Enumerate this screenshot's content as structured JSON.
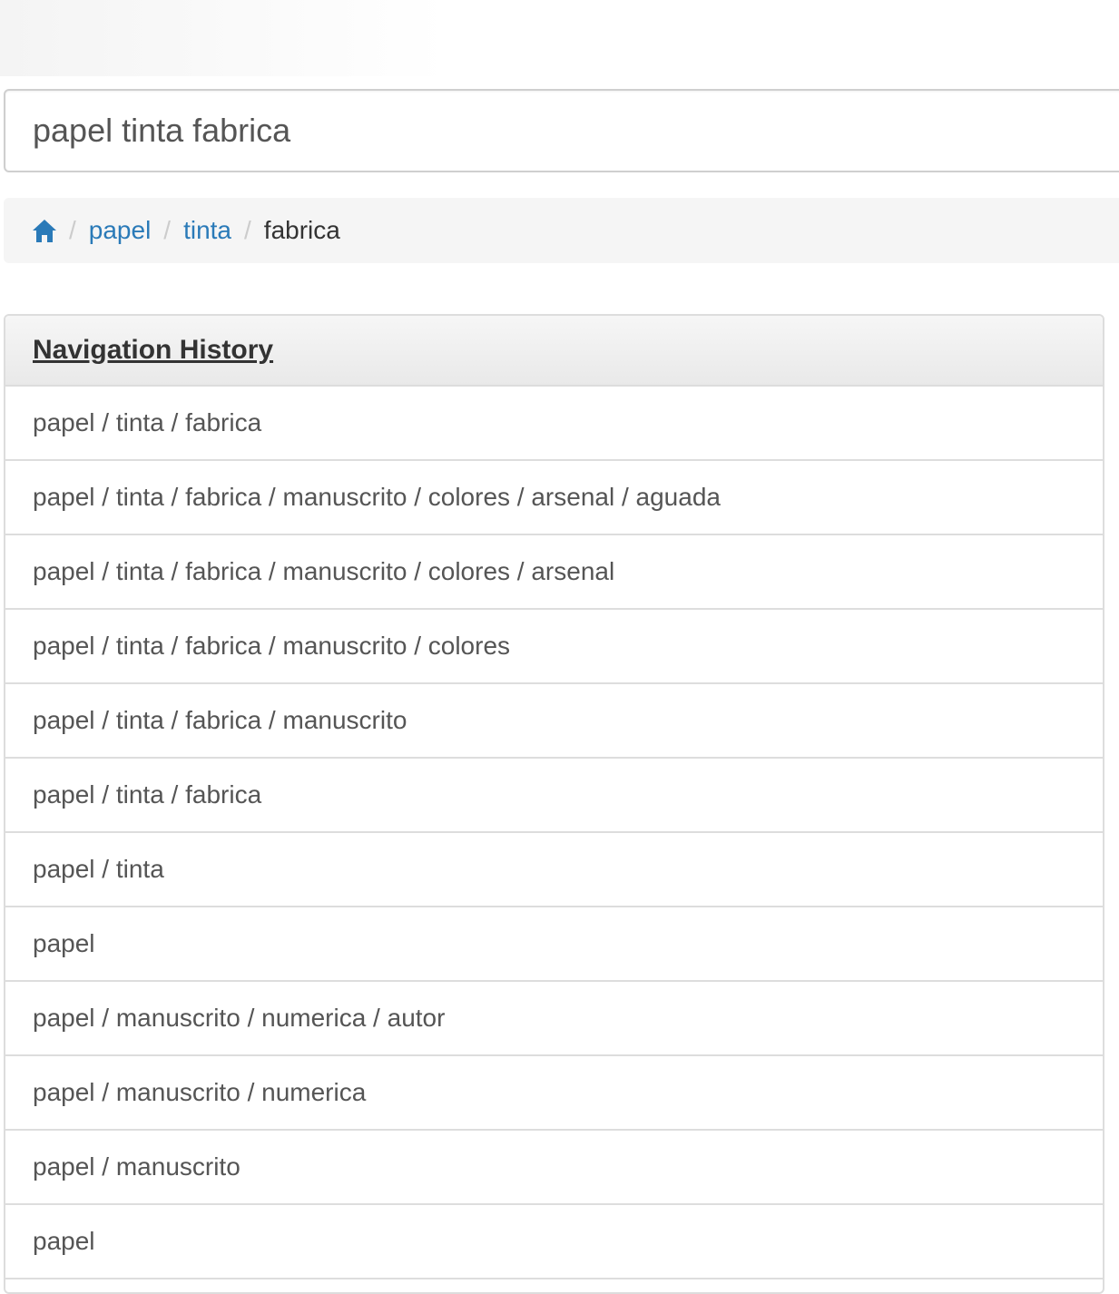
{
  "search": {
    "value": "papel tinta fabrica"
  },
  "breadcrumb": {
    "home_icon": "home-icon",
    "separator": "/",
    "items": [
      "papel",
      "tinta"
    ],
    "active": "fabrica"
  },
  "colors": {
    "link": "#2a7ab8",
    "text": "#555555",
    "heading": "#333333"
  },
  "history": {
    "title": "Navigation History",
    "items": [
      "papel / tinta / fabrica",
      "papel / tinta / fabrica / manuscrito / colores / arsenal / aguada",
      "papel / tinta / fabrica / manuscrito / colores / arsenal",
      "papel / tinta / fabrica / manuscrito / colores",
      "papel / tinta / fabrica / manuscrito",
      "papel / tinta / fabrica",
      "papel / tinta",
      "papel",
      "papel / manuscrito / numerica / autor",
      "papel / manuscrito / numerica",
      "papel / manuscrito",
      "papel"
    ]
  }
}
